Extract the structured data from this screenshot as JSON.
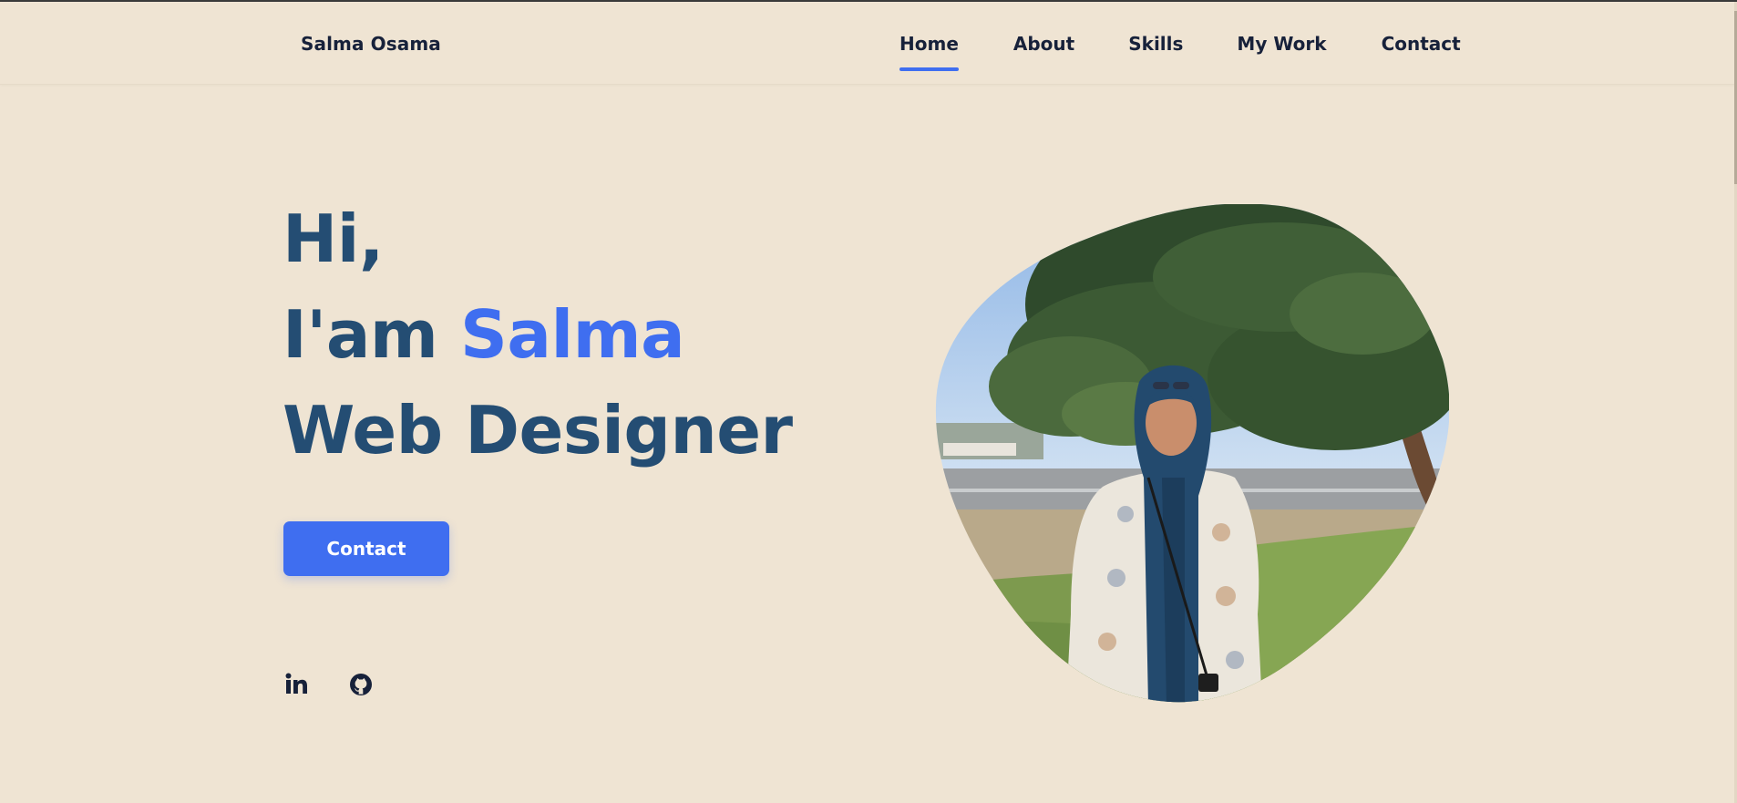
{
  "header": {
    "brand": "Salma Osama",
    "nav": [
      {
        "label": "Home",
        "active": true
      },
      {
        "label": "About",
        "active": false
      },
      {
        "label": "Skills",
        "active": false
      },
      {
        "label": "My Work",
        "active": false
      },
      {
        "label": "Contact",
        "active": false
      }
    ]
  },
  "hero": {
    "line1": "Hi,",
    "line2_prefix": "I'am ",
    "line2_name": "Salma",
    "line3": "Web Designer",
    "cta_label": "Contact"
  },
  "socials": [
    {
      "icon": "linkedin-icon"
    },
    {
      "icon": "github-icon"
    }
  ],
  "colors": {
    "background": "#efe4d3",
    "accent": "#3f6ef0",
    "heading": "#244d73",
    "nav_text": "#17213a"
  }
}
